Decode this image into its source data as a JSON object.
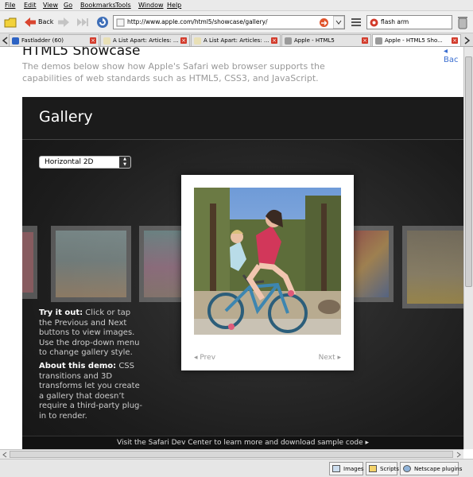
{
  "menu": [
    "File",
    "Edit",
    "View",
    "Go",
    "Bookmarks",
    "Tools",
    "Window",
    "Help"
  ],
  "toolbar": {
    "back_label": "Back",
    "url": "http://www.apple.com/html5/showcase/gallery/",
    "search": "flash arm"
  },
  "tabs": [
    {
      "label": "Fastladder (60)",
      "active": false
    },
    {
      "label": "A List Apart: Articles: ...",
      "active": false
    },
    {
      "label": "A List Apart: Articles: ...",
      "active": false
    },
    {
      "label": "Apple - HTML5",
      "active": false
    },
    {
      "label": "Apple - HTML5 Sho...",
      "active": true
    }
  ],
  "page": {
    "heading": "HTML5 Showcase",
    "description": "The demos below show how Apple's Safari web browser supports the capabilities of web standards such as HTML5, CSS3, and JavaScript.",
    "back_link": "Bac"
  },
  "gallery": {
    "title": "Gallery",
    "style_select": "Horizontal 2D",
    "prev": "Prev",
    "next": "Next",
    "try_heading": "Try it out:",
    "try_text": " Click or tap the Previous and Next buttons to view images. Use the drop-down menu to change gallery style.",
    "about_heading": "About this demo:",
    "about_text": " CSS transitions and 3D transforms let you create a gallery that doesn’t require a third-party plug-in to render.",
    "footer": "Visit the Safari Dev Center to learn more and download sample code"
  },
  "statusbar": {
    "images": "Images",
    "scripts": "Scripts",
    "plugins": "Netscape plugins"
  },
  "icons": [
    "bookmark-icon",
    "back-arrow-icon",
    "forward-arrow-icon",
    "fast-forward-icon",
    "reload-icon",
    "search-engine-icon",
    "trash-icon"
  ],
  "colors": {
    "back_arrow": "#d9452f",
    "gallery_bg": "#1c1c1c",
    "link": "#3a6ed0",
    "close": "#d23a2a"
  }
}
